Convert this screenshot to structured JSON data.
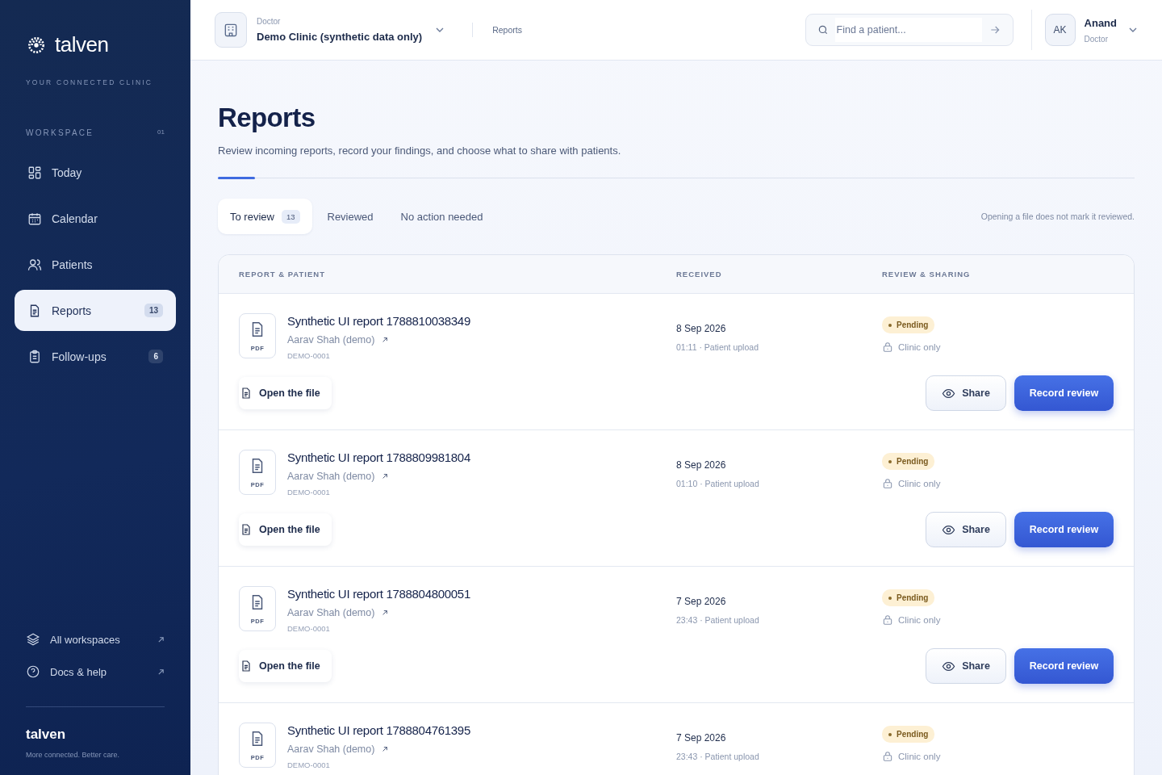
{
  "brand": {
    "name": "talven",
    "tagline": "YOUR CONNECTED CLINIC"
  },
  "sidebar": {
    "section": "WORKSPACE",
    "section_index": "01",
    "items": [
      {
        "label": "Today",
        "selected": false
      },
      {
        "label": "Calendar",
        "selected": false
      },
      {
        "label": "Patients",
        "selected": false
      },
      {
        "label": "Reports",
        "selected": true,
        "badge": "13"
      },
      {
        "label": "Follow-ups",
        "selected": false,
        "badge": "6"
      }
    ],
    "links": [
      {
        "label": "All workspaces"
      },
      {
        "label": "Docs & help"
      }
    ],
    "footer": {
      "name": "talven",
      "slogan": "More connected. Better care."
    }
  },
  "topbar": {
    "role": "Doctor",
    "clinic": "Demo Clinic (synthetic data only)",
    "breadcrumb": "Reports",
    "search": {
      "placeholder": "Find a patient..."
    },
    "user": {
      "initials": "AK",
      "name": "Anand",
      "role": "Doctor"
    }
  },
  "page": {
    "title": "Reports",
    "subtitle": "Review incoming reports, record your findings, and choose what to share with patients.",
    "note": "Opening a file does not mark it reviewed."
  },
  "tabs": [
    {
      "label": "To review",
      "count": "13",
      "selected": true
    },
    {
      "label": "Reviewed",
      "selected": false
    },
    {
      "label": "No action needed",
      "selected": false
    }
  ],
  "table": {
    "columns": [
      "REPORT & PATIENT",
      "RECEIVED",
      "REVIEW & SHARING"
    ],
    "rows": [
      {
        "file_type": "PDF",
        "title": "Synthetic UI report 1788810038349",
        "patient": "Aarav Shah (demo)",
        "patient_id": "DEMO-0001",
        "date": "8 Sep 2026",
        "time": "01:11 · Patient upload",
        "status": "Pending",
        "sharing": "Clinic only",
        "open_label": "Open the file",
        "share_label": "Share",
        "review_label": "Record review"
      },
      {
        "file_type": "PDF",
        "title": "Synthetic UI report 1788809981804",
        "patient": "Aarav Shah (demo)",
        "patient_id": "DEMO-0001",
        "date": "8 Sep 2026",
        "time": "01:10 · Patient upload",
        "status": "Pending",
        "sharing": "Clinic only",
        "open_label": "Open the file",
        "share_label": "Share",
        "review_label": "Record review"
      },
      {
        "file_type": "PDF",
        "title": "Synthetic UI report 1788804800051",
        "patient": "Aarav Shah (demo)",
        "patient_id": "DEMO-0001",
        "date": "7 Sep 2026",
        "time": "23:43 · Patient upload",
        "status": "Pending",
        "sharing": "Clinic only",
        "open_label": "Open the file",
        "share_label": "Share",
        "review_label": "Record review"
      },
      {
        "file_type": "PDF",
        "title": "Synthetic UI report 1788804761395",
        "patient": "Aarav Shah (demo)",
        "patient_id": "DEMO-0001",
        "date": "7 Sep 2026",
        "time": "23:43 · Patient upload",
        "status": "Pending",
        "sharing": "Clinic only"
      }
    ]
  }
}
